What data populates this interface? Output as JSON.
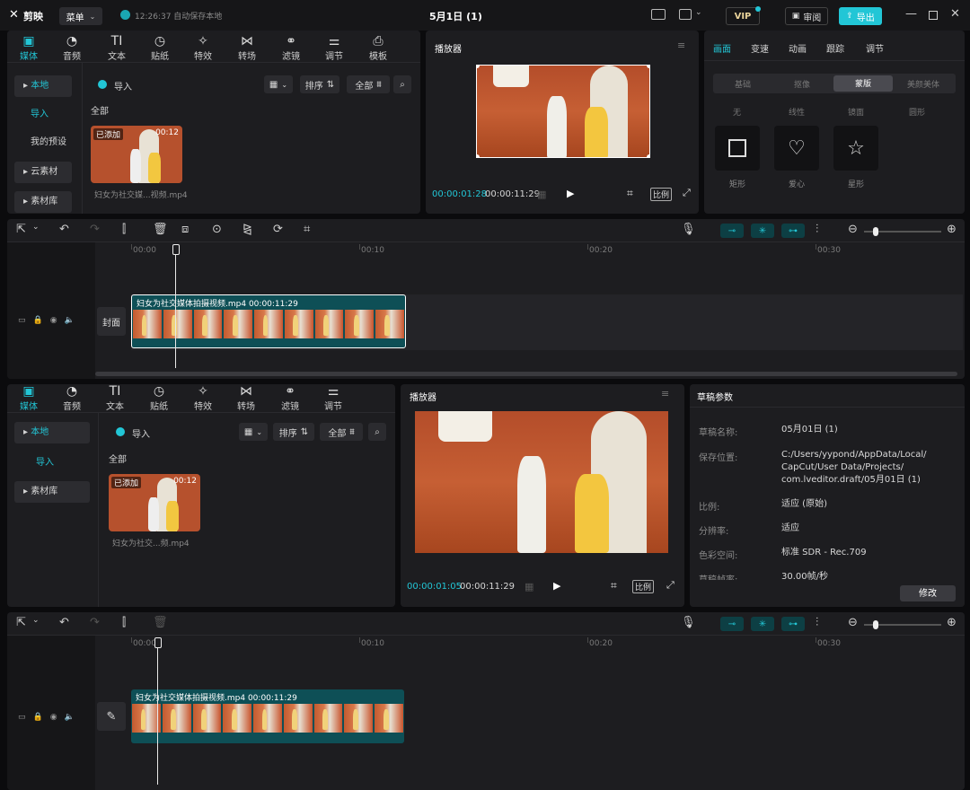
{
  "titlebar": {
    "app_name": "剪映",
    "menu_label": "菜单",
    "autosave": "12:26:37 自动保存本地",
    "project_title": "5月1日 (1)",
    "vip": "VIP",
    "review": "审阅",
    "export": "导出"
  },
  "toolbar": {
    "tools": [
      "媒体",
      "音频",
      "文本",
      "贴纸",
      "特效",
      "转场",
      "滤镜",
      "调节",
      "模板"
    ],
    "tools2": [
      "媒体",
      "音频",
      "文本",
      "贴纸",
      "特效",
      "转场",
      "滤镜",
      "调节"
    ]
  },
  "media": {
    "nav": [
      "本地",
      "导入",
      "我的预设",
      "云素材",
      "素材库"
    ],
    "nav2": [
      "本地",
      "导入",
      "素材库"
    ],
    "import": "导入",
    "sort": "排序",
    "all_filter": "全部",
    "section": "全部",
    "clip_tag": "已添加",
    "clip_duration": "00:12",
    "clip_name": "妇女为社交媒...视频.mp4",
    "clip_name2": "妇女为社交...频.mp4"
  },
  "player": {
    "title": "播放器",
    "current_time": "00:00:01:28",
    "total_time": "00:00:11:29",
    "ratio": "比例",
    "current_time2": "00:00:01:05",
    "total_time2": "00:00:11:29"
  },
  "inspector": {
    "tabs": [
      "画面",
      "变速",
      "动画",
      "跟踪",
      "调节"
    ],
    "subtabs": [
      "基础",
      "抠像",
      "蒙版",
      "美颜美体"
    ],
    "mask_labels": [
      "无",
      "线性",
      "镜面",
      "圆形"
    ],
    "mask_shapes": [
      "矩形",
      "爱心",
      "星形"
    ]
  },
  "draft": {
    "title": "草稿参数",
    "rows": [
      {
        "label": "草稿名称:",
        "value": "05月01日 (1)"
      },
      {
        "label": "保存位置:",
        "value": "C:/Users/yypond/AppData/Local/\nCapCut/User Data/Projects/\ncom.lveditor.draft/05月01日 (1)"
      },
      {
        "label": "比例:",
        "value": "适应 (原始)"
      },
      {
        "label": "分辨率:",
        "value": "适应"
      },
      {
        "label": "色彩空间:",
        "value": "标准 SDR - Rec.709"
      },
      {
        "label": "草稿帧率:",
        "value": "30.00帧/秒"
      }
    ],
    "modify": "修改"
  },
  "timeline": {
    "ruler": [
      "00:00",
      "00:10",
      "00:20",
      "00:30"
    ],
    "cover": "封面",
    "clip_name": "妇女为社交媒体拍摄视频.mp4",
    "clip_duration": "00:00:11:29"
  },
  "colors": {
    "accent": "#22c6d6",
    "panel": "#1d1d20",
    "bg": "#0b0b0d",
    "clip": "#0e4f56"
  }
}
